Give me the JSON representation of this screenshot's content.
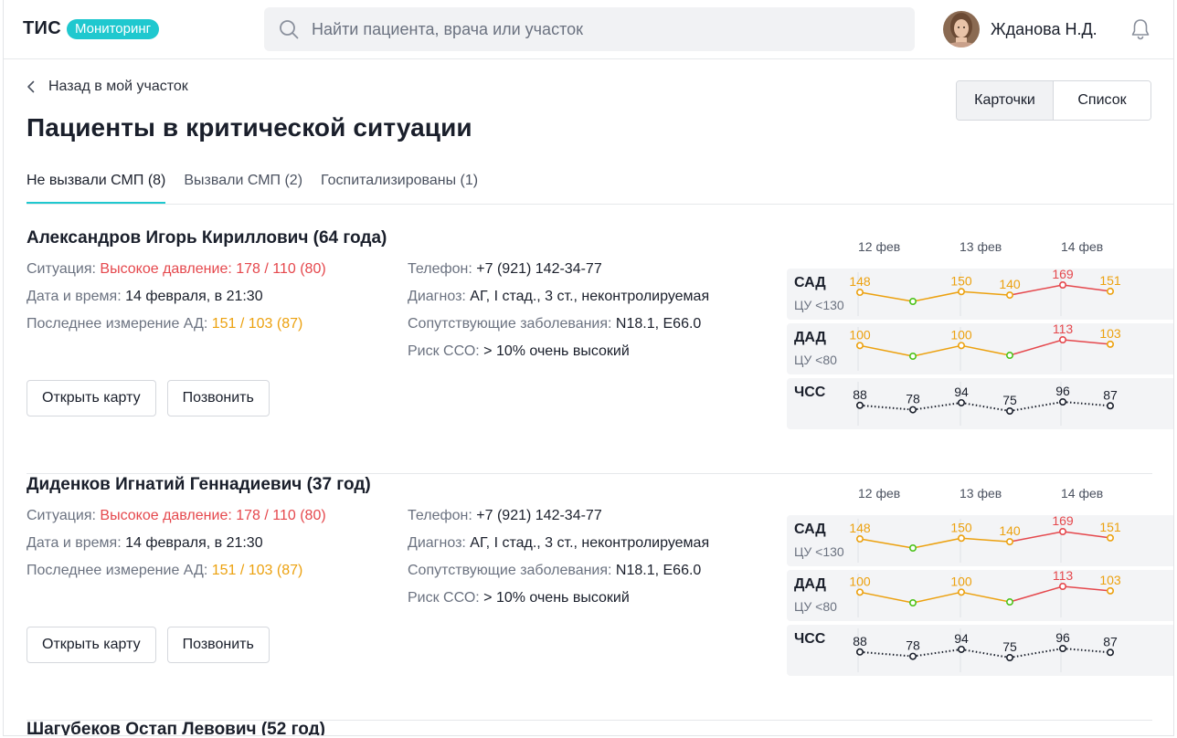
{
  "header": {
    "logo": "ТИС",
    "badge": "Мониторинг",
    "search_placeholder": "Найти пациента, врача или участок",
    "user_name": "Жданова Н.Д."
  },
  "page": {
    "back_label": "Назад в мой участок",
    "title": "Пациенты в критической ситуации",
    "view_cards": "Карточки",
    "view_list": "Список"
  },
  "tabs": [
    {
      "label": "Не вызвали СМП (8)",
      "active": true
    },
    {
      "label": "Вызвали СМП (2)",
      "active": false
    },
    {
      "label": "Госпитализированы (1)",
      "active": false
    }
  ],
  "labels": {
    "situation": "Ситуация:",
    "datetime": "Дата и время:",
    "last_bp": "Последнее измерение АД:",
    "phone": "Телефон:",
    "diagnosis": "Диагноз:",
    "comorbid": "Сопутствующие заболевания:",
    "risk": "Риск ССО:",
    "open_card": "Открыть карту",
    "call": "Позвонить"
  },
  "vital_dates": [
    "12 фев",
    "13 фев",
    "14 фев"
  ],
  "colors": {
    "accent": "#1fc8cf",
    "red": "#e5484d",
    "orange": "#eca10f",
    "green": "#4cc21a",
    "lime": "#a8c61a"
  },
  "patients": [
    {
      "name": "Александров Игорь Кириллович (64 года)",
      "situation": "Высокое давление: 178 / 110 (80)",
      "datetime": "14 февраля, в 21:30",
      "last_bp": "151 / 103 (87)",
      "phone": "+7 (921) 142-34-77",
      "diagnosis": "АГ, I стад., 3 ст., неконтролируемая",
      "comorbid": "N18.1, E66.0",
      "risk": "> 10% очень высокий",
      "vitals": [
        {
          "name": "САД",
          "target": "ЦУ <130",
          "values": [
            148,
            122,
            150,
            140,
            169,
            151
          ],
          "labels": [
            "148",
            "",
            "150",
            "140",
            "169",
            "151"
          ]
        },
        {
          "name": "ДАД",
          "target": "ЦУ <80",
          "values": [
            100,
            76,
            100,
            78,
            113,
            103
          ],
          "labels": [
            "100",
            "",
            "100",
            "",
            "113",
            "103"
          ]
        },
        {
          "name": "ЧСС",
          "target": "",
          "values": [
            88,
            78,
            94,
            75,
            96,
            87
          ],
          "labels": [
            "88",
            "78",
            "94",
            "75",
            "96",
            "87"
          ]
        }
      ]
    },
    {
      "name": "Диденков Игнатий Геннадиевич (37 год)",
      "situation": "Высокое давление: 178 / 110 (80)",
      "datetime": "14 февраля, в 21:30",
      "last_bp": "151 / 103 (87)",
      "phone": "+7 (921) 142-34-77",
      "diagnosis": "АГ, I стад., 3 ст., неконтролируемая",
      "comorbid": "N18.1, E66.0",
      "risk": "> 10% очень высокий",
      "vitals": [
        {
          "name": "САД",
          "target": "ЦУ <130",
          "values": [
            148,
            122,
            150,
            140,
            169,
            151
          ],
          "labels": [
            "148",
            "",
            "150",
            "140",
            "169",
            "151"
          ]
        },
        {
          "name": "ДАД",
          "target": "ЦУ <80",
          "values": [
            100,
            76,
            100,
            78,
            113,
            103
          ],
          "labels": [
            "100",
            "",
            "100",
            "",
            "113",
            "103"
          ]
        },
        {
          "name": "ЧСС",
          "target": "",
          "values": [
            88,
            78,
            94,
            75,
            96,
            87
          ],
          "labels": [
            "88",
            "78",
            "94",
            "75",
            "96",
            "87"
          ]
        }
      ]
    }
  ],
  "partial_patient_name": "Шагубеков Остап Левович (52 год)"
}
